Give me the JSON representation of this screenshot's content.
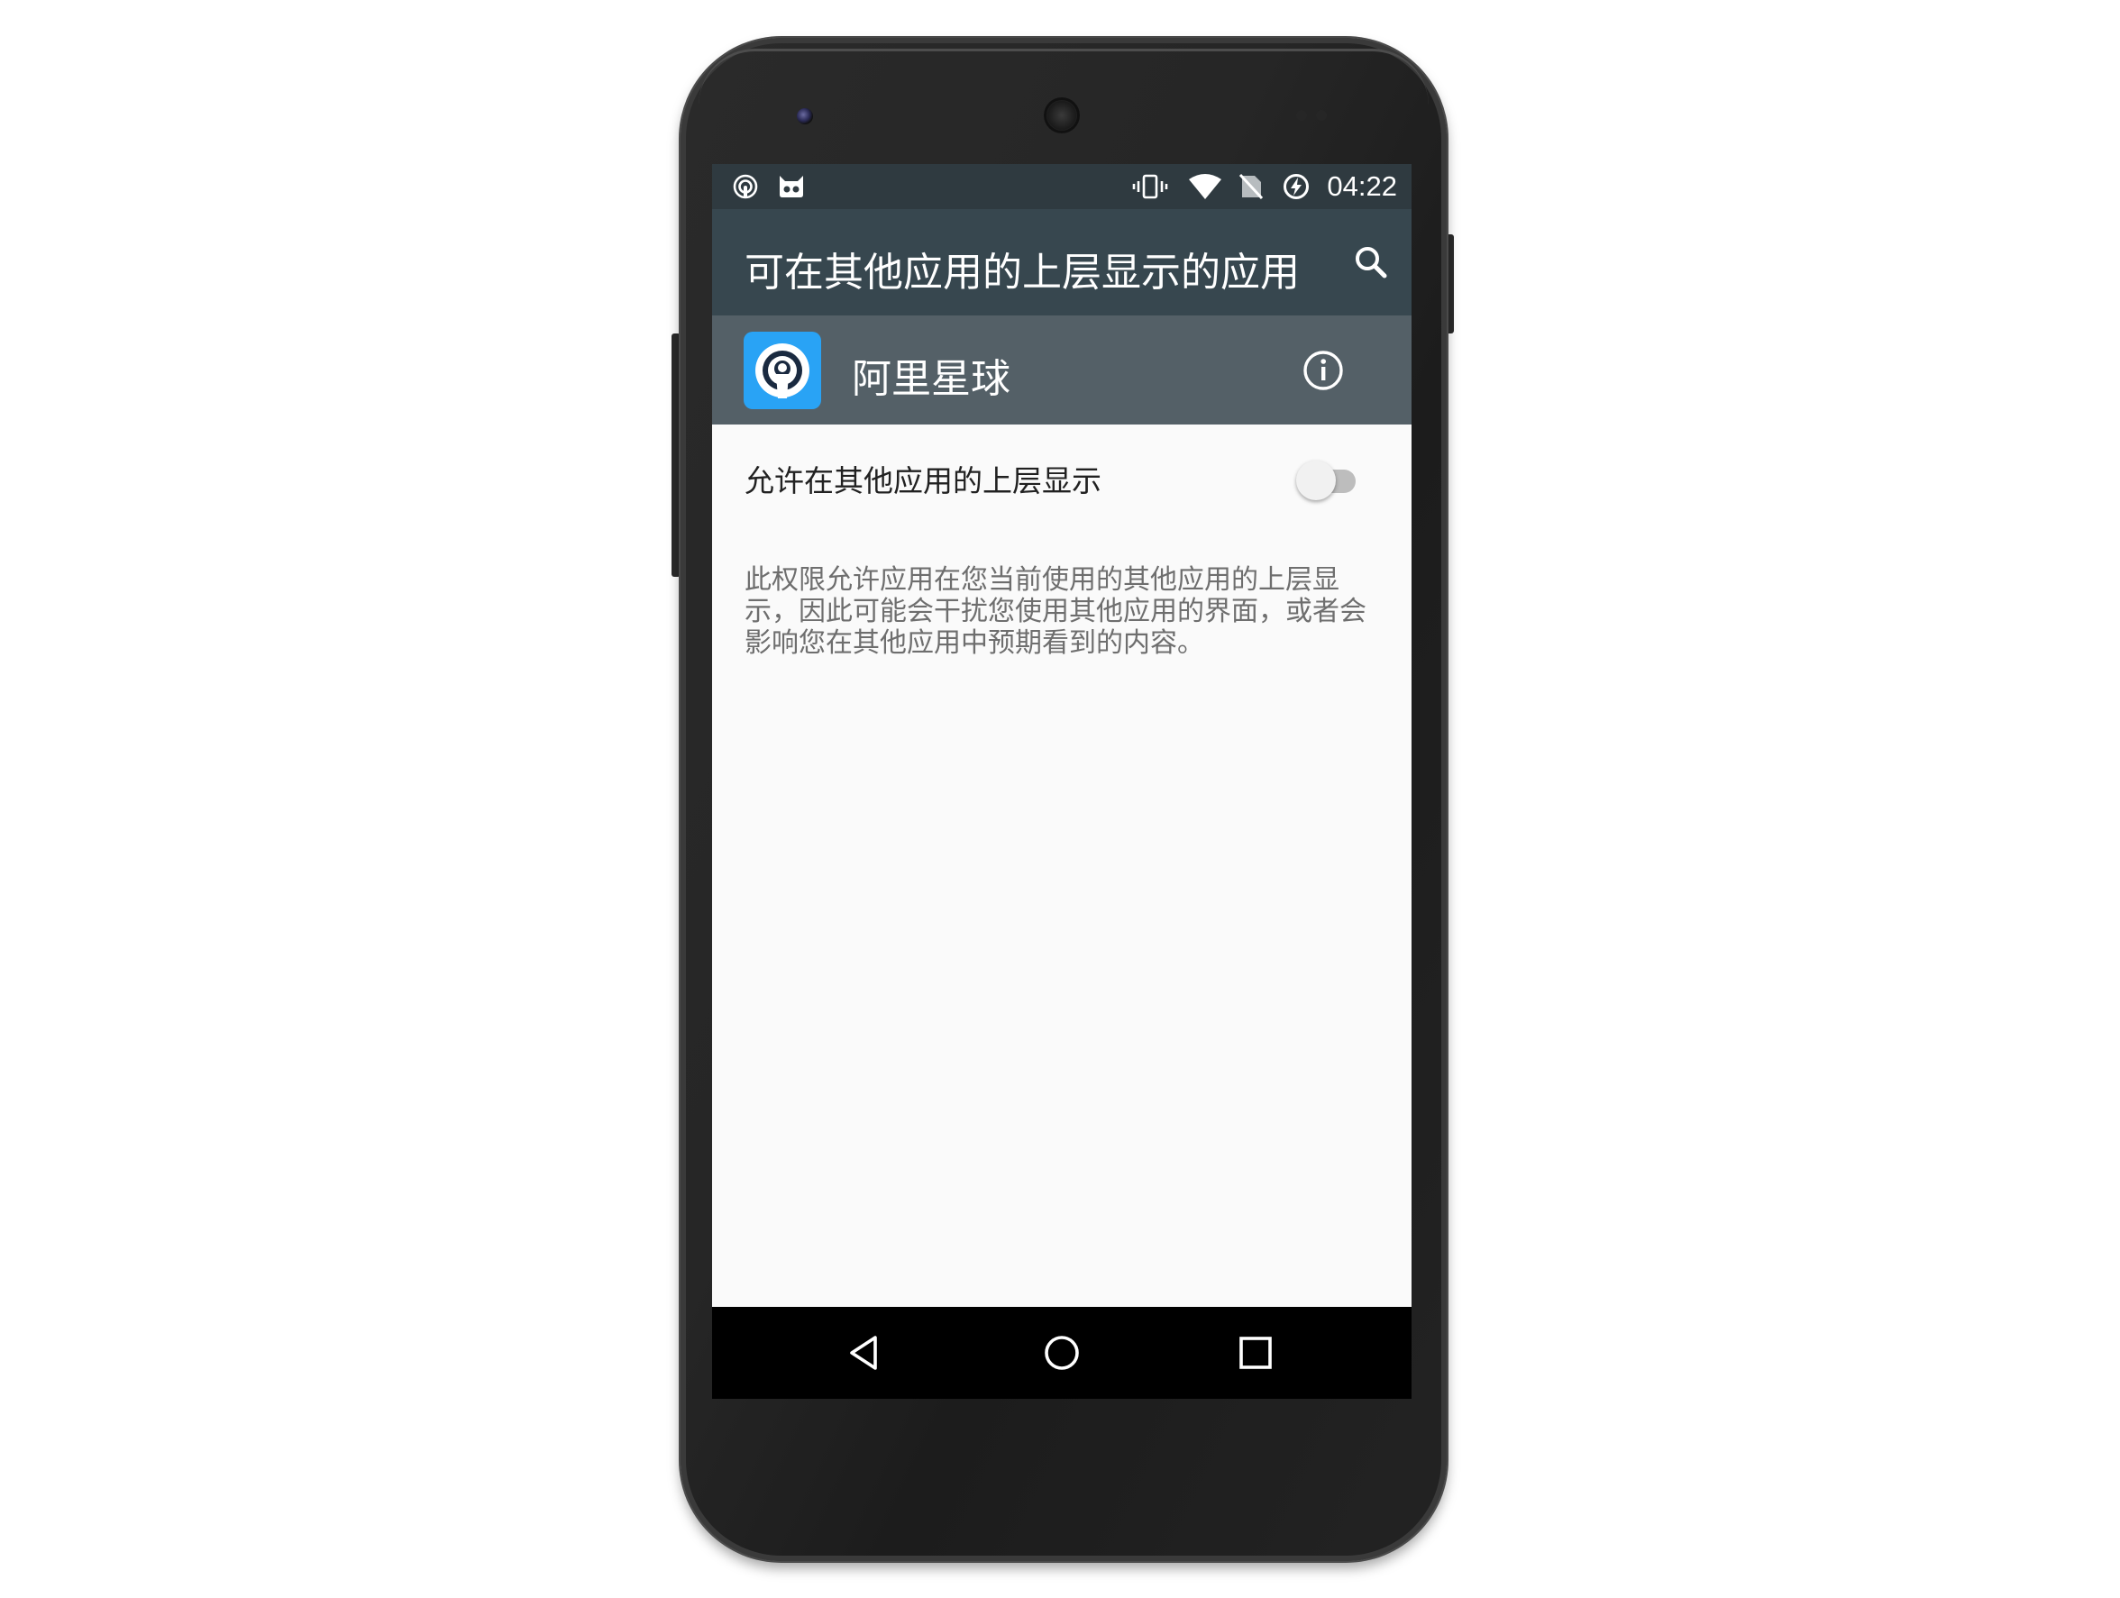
{
  "status_bar": {
    "time": "04:22",
    "left_icons": [
      "podcast-icon",
      "cyanogen-mascot-icon"
    ],
    "right_icons": [
      "vibrate-icon",
      "wifi-icon",
      "no-sim-icon",
      "battery-charging-icon"
    ]
  },
  "app_bar": {
    "title": "可在其他应用的上层显示的应用",
    "search_icon": "search-icon"
  },
  "app_header": {
    "app_name": "阿里星球",
    "info_icon": "info-icon"
  },
  "permission": {
    "label": "允许在其他应用的上层显示",
    "enabled": false,
    "description": "此权限允许应用在您当前使用的其他应用的上层显示，因此可能会干扰您使用其他应用的界面，或者会影响您在其他应用中预期看到的内容。"
  },
  "nav_bar": {
    "icons": [
      "back-icon",
      "home-icon",
      "recents-icon"
    ]
  },
  "colors": {
    "status_bar": "#2f3a40",
    "app_bar": "#37474f",
    "app_header": "#546067",
    "app_icon": "#29a3f5",
    "screen_background": "#fafafa"
  }
}
